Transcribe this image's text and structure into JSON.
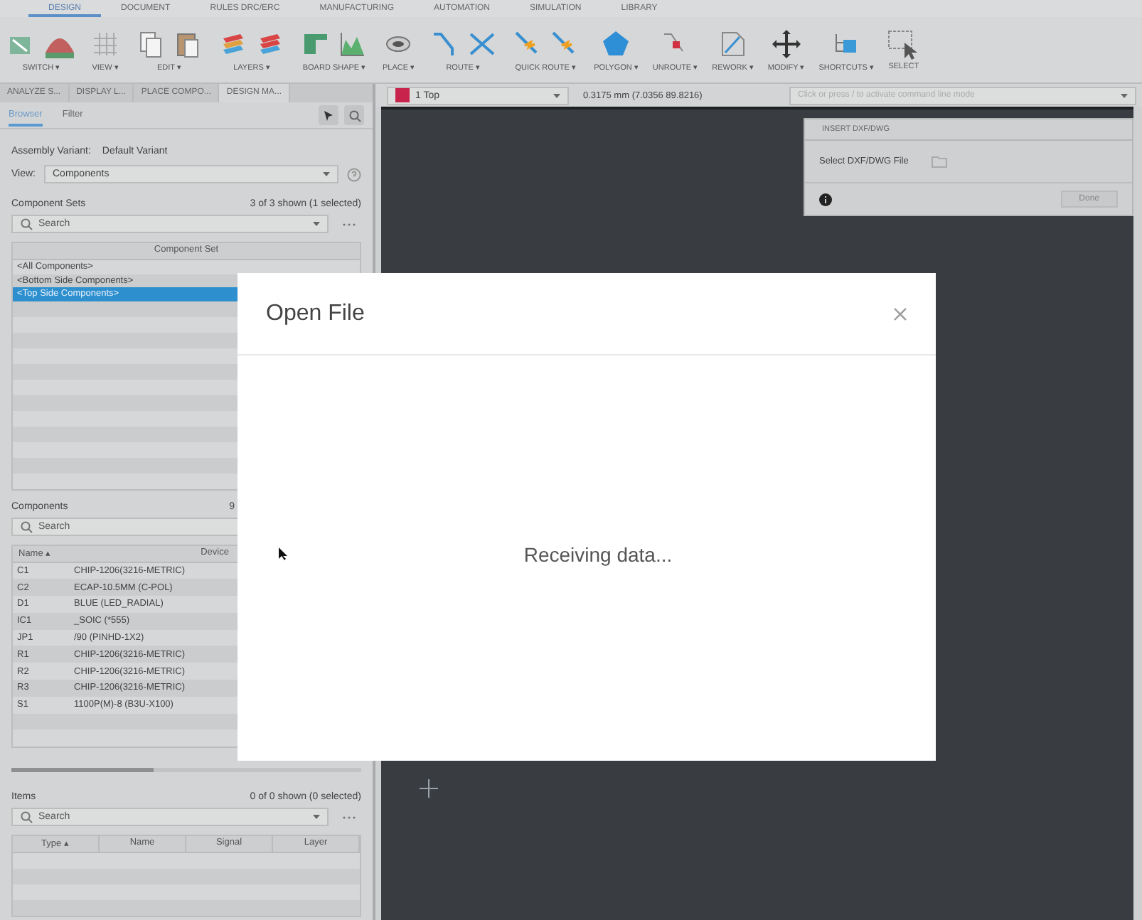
{
  "menu_tabs": [
    {
      "label": "DESIGN",
      "selected": true
    },
    {
      "label": "DOCUMENT",
      "selected": false
    },
    {
      "label": "RULES DRC/ERC",
      "selected": false
    },
    {
      "label": "MANUFACTURING",
      "selected": false
    },
    {
      "label": "AUTOMATION",
      "selected": false
    },
    {
      "label": "SIMULATION",
      "selected": false
    },
    {
      "label": "LIBRARY",
      "selected": false
    }
  ],
  "toolbar": [
    {
      "label": "SWITCH ▾"
    },
    {
      "label": "VIEW ▾"
    },
    {
      "label": "EDIT ▾"
    },
    {
      "label": "LAYERS ▾"
    },
    {
      "label": "BOARD SHAPE ▾"
    },
    {
      "label": "PLACE ▾"
    },
    {
      "label": "ROUTE ▾"
    },
    {
      "label": "QUICK ROUTE ▾"
    },
    {
      "label": "POLYGON ▾"
    },
    {
      "label": "UNROUTE ▾"
    },
    {
      "label": "REWORK ▾"
    },
    {
      "label": "MODIFY ▾"
    },
    {
      "label": "SHORTCUTS ▾"
    },
    {
      "label": "SELECT"
    }
  ],
  "panel_tabs": [
    {
      "label": "ANALYZE S...",
      "selected": false
    },
    {
      "label": "DISPLAY L...",
      "selected": false
    },
    {
      "label": "PLACE COMPO...",
      "selected": false
    },
    {
      "label": "DESIGN MA...",
      "selected": true
    }
  ],
  "browser_tabs": [
    {
      "label": "Browser",
      "selected": true
    },
    {
      "label": "Filter",
      "selected": false
    }
  ],
  "assembly_variant": {
    "label": "Assembly Variant:",
    "value": "Default Variant"
  },
  "view": {
    "label": "View:",
    "value": "Components"
  },
  "component_sets": {
    "title": "Component Sets",
    "count": "3 of 3 shown (1 selected)",
    "search_placeholder": "Search",
    "column": "Component Set",
    "rows": [
      {
        "name": "<All Components>",
        "selected": false
      },
      {
        "name": "<Bottom Side Components>",
        "selected": false
      },
      {
        "name": "<Top Side Components>",
        "selected": true
      }
    ]
  },
  "components": {
    "title": "Components",
    "count": "9",
    "search_placeholder": "Search",
    "columns": [
      "Name ▴",
      "Device"
    ],
    "rows": [
      {
        "name": "C1",
        "device": "CHIP-1206(3216-METRIC)"
      },
      {
        "name": "C2",
        "device": "ECAP-10.5MM (C-POL)"
      },
      {
        "name": "D1",
        "device": "BLUE (LED_RADIAL)"
      },
      {
        "name": "IC1",
        "device": "_SOIC (*555)"
      },
      {
        "name": "JP1",
        "device": "/90 (PINHD-1X2)"
      },
      {
        "name": "R1",
        "device": "CHIP-1206(3216-METRIC)"
      },
      {
        "name": "R2",
        "device": "CHIP-1206(3216-METRIC)"
      },
      {
        "name": "R3",
        "device": "CHIP-1206(3216-METRIC)"
      },
      {
        "name": "S1",
        "device": "1100P(M)-8 (B3U-X100)"
      }
    ]
  },
  "items": {
    "title": "Items",
    "count": "0 of 0 shown (0 selected)",
    "search_placeholder": "Search",
    "columns": [
      "Type ▴",
      "Name",
      "Signal",
      "Layer"
    ]
  },
  "layer_select": {
    "value": "1 Top"
  },
  "coordinates": "0.3175 mm (7.0356 89.8216)",
  "command_line": {
    "placeholder": "Click or press / to activate command line mode"
  },
  "insert_panel": {
    "title": "INSERT DXF/DWG",
    "field_label": "Select DXF/DWG File",
    "button": "Done"
  },
  "dialog": {
    "title": "Open File",
    "message": "Receiving data..."
  }
}
